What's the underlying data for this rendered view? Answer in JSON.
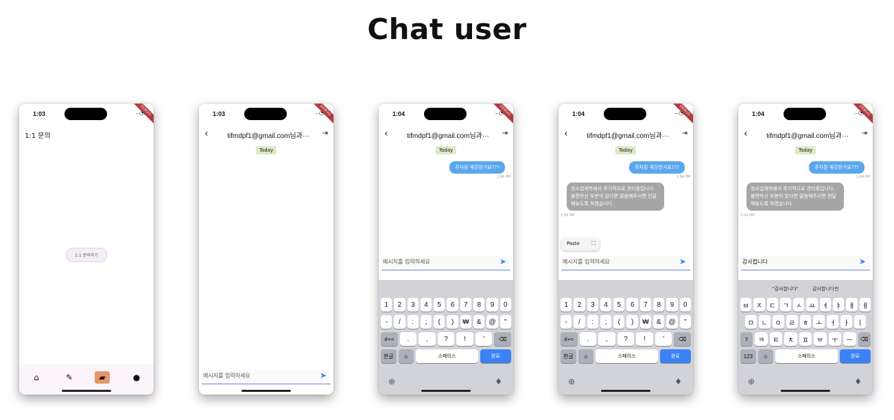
{
  "page_title": "Chat user",
  "phones": [
    {
      "time": "1:03",
      "ribbon": "DEBUG",
      "title": "1:1 문의",
      "start_button": "1:1 문의하기"
    },
    {
      "time": "1:03",
      "ribbon": "DEBUG",
      "header_title": "tifmdpf1@gmail.com님과···",
      "today": "Today",
      "input_placeholder": "메시지를 입력하세요"
    },
    {
      "time": "1:04",
      "ribbon": "DEBUG",
      "header_title": "tifmdpf1@gmail.com님과···",
      "today": "Today",
      "my_message": "주차장 깨끗한가요???",
      "my_time": "1:04 PM",
      "input_placeholder": "메시지를 입력하세요"
    },
    {
      "time": "1:04",
      "ribbon": "DEBUG",
      "header_title": "tifmdpf1@gmail.com님과···",
      "today": "Today",
      "my_message": "주차장 깨끗한가요???",
      "my_time": "1:04 PM",
      "other_message": "청소업체측에서 주기적으로 관리중입니다. 불편하신 부분이 있다면 말씀해주시면 전달해놓도록 하겠습니다.",
      "other_time": "1:04 PM",
      "paste_label": "Paste",
      "input_placeholder": "메시지를 입력하세요"
    },
    {
      "time": "1:04",
      "ribbon": "DEBUG",
      "header_title": "tifmdpf1@gmail.com님과···",
      "today": "Today",
      "my_message": "주차장 깨끗한가요???",
      "my_time": "1:04 PM",
      "other_message": "청소업체측에서 주기적으로 관리중입니다. 불편하신 부분이 있다면 말씀해주시면 전달해놓도록 하겠습니다.",
      "other_time": "1:04 PM",
      "input_text": "감사합니다",
      "suggest1": "\"감사합니다\"",
      "suggest2": "감사합니다만"
    }
  ],
  "keyboard_num": {
    "row1": [
      "1",
      "2",
      "3",
      "4",
      "5",
      "6",
      "7",
      "8",
      "9",
      "0"
    ],
    "row2": [
      "-",
      "/",
      ":",
      ";",
      "(",
      ")",
      "₩",
      "&",
      "@",
      "\""
    ],
    "row3": [
      "#+=",
      ".",
      ",",
      "?",
      "!",
      "'",
      "⌫"
    ],
    "row4": [
      "한글",
      "☺",
      "스페이스",
      "완료"
    ]
  },
  "keyboard_kor": {
    "row1": [
      "ㅂ",
      "ㅈ",
      "ㄷ",
      "ㄱ",
      "ㅅ",
      "ㅛ",
      "ㅕ",
      "ㅑ",
      "ㅐ",
      "ㅔ"
    ],
    "row2": [
      "ㅁ",
      "ㄴ",
      "ㅇ",
      "ㄹ",
      "ㅎ",
      "ㅗ",
      "ㅓ",
      "ㅏ",
      "ㅣ"
    ],
    "row3": [
      "⇧",
      "ㅋ",
      "ㅌ",
      "ㅊ",
      "ㅍ",
      "ㅠ",
      "ㅜ",
      "ㅡ",
      "⌫"
    ],
    "row4": [
      "123",
      "☺",
      "스페이스",
      "완료"
    ]
  },
  "colors": {
    "send": "#3b82f6",
    "my_bubble": "#5aa7ee",
    "other_bubble": "#a6a6a6",
    "nav_active": "#e8956a"
  }
}
